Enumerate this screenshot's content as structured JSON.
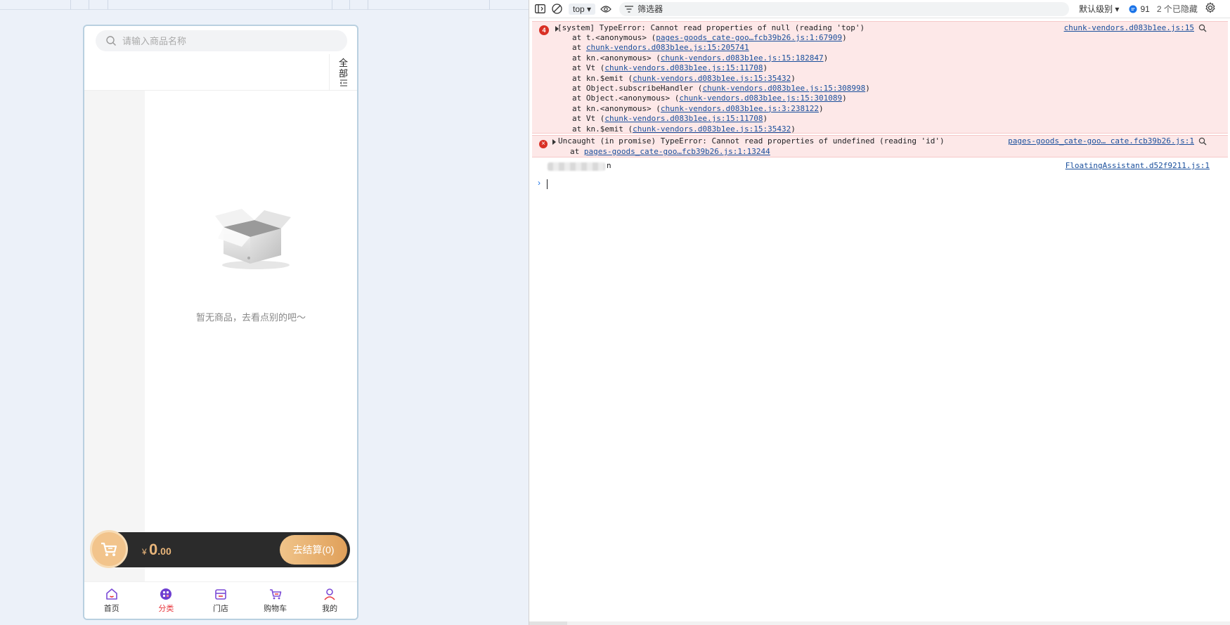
{
  "preview": {
    "search": {
      "placeholder": "请输入商品名称"
    },
    "all_toggle": {
      "char1": "全",
      "char2": "部"
    },
    "empty_text": "暂无商品，去看点别的吧～",
    "cart": {
      "currency": "¥",
      "amount_int": "0",
      "amount_dec": ".00",
      "checkout_label": "去结算(0)"
    },
    "tabbar": [
      {
        "label": "首页",
        "icon": "home-icon",
        "active": false
      },
      {
        "label": "分类",
        "icon": "category-icon",
        "active": true
      },
      {
        "label": "门店",
        "icon": "store-icon",
        "active": false
      },
      {
        "label": "购物车",
        "icon": "cart-icon",
        "active": false
      },
      {
        "label": "我的",
        "icon": "user-icon",
        "active": false
      }
    ],
    "colors": {
      "active_tab": "#e8363c",
      "accent": "#e8b57a",
      "cart_bar": "#2b2b2b"
    }
  },
  "devtools": {
    "toolbar": {
      "context": "top",
      "filter_placeholder": "筛选器",
      "level": "默认级别",
      "issues_count": "91",
      "hidden": "2 个已隐藏"
    },
    "error1": {
      "count": "4",
      "message": "[system] TypeError: Cannot read properties of null (reading 'top')",
      "source": "chunk-vendors.d083b1ee.js:15",
      "stack": [
        {
          "pre": "at t.<anonymous> (",
          "link": "pages-goods_cate-goo…fcb39b26.js:1:67909",
          "post": ")"
        },
        {
          "pre": "at ",
          "link": "chunk-vendors.d083b1ee.js:15:205741",
          "post": ""
        },
        {
          "pre": "at kn.<anonymous> (",
          "link": "chunk-vendors.d083b1ee.js:15:182847",
          "post": ")"
        },
        {
          "pre": "at Vt (",
          "link": "chunk-vendors.d083b1ee.js:15:11708",
          "post": ")"
        },
        {
          "pre": "at kn.$emit (",
          "link": "chunk-vendors.d083b1ee.js:15:35432",
          "post": ")"
        },
        {
          "pre": "at Object.subscribeHandler (",
          "link": "chunk-vendors.d083b1ee.js:15:308998",
          "post": ")"
        },
        {
          "pre": "at Object.<anonymous> (",
          "link": "chunk-vendors.d083b1ee.js:15:301089",
          "post": ")"
        },
        {
          "pre": "at kn.<anonymous> (",
          "link": "chunk-vendors.d083b1ee.js:3:238122",
          "post": ")"
        },
        {
          "pre": "at Vt (",
          "link": "chunk-vendors.d083b1ee.js:15:11708",
          "post": ")"
        },
        {
          "pre": "at kn.$emit (",
          "link": "chunk-vendors.d083b1ee.js:15:35432",
          "post": ")"
        }
      ]
    },
    "error2": {
      "message": "Uncaught (in promise) TypeError: Cannot read properties of undefined (reading 'id')",
      "source": "pages-goods_cate-goo… cate.fcb39b26.js:1",
      "at_pre": "at ",
      "at_link": "pages-goods_cate-goo…fcb39b26.js:1:13244"
    },
    "log": {
      "text": "n",
      "source": "FloatingAssistant.d52f9211.js:1"
    },
    "prompt_symbol": "›"
  }
}
